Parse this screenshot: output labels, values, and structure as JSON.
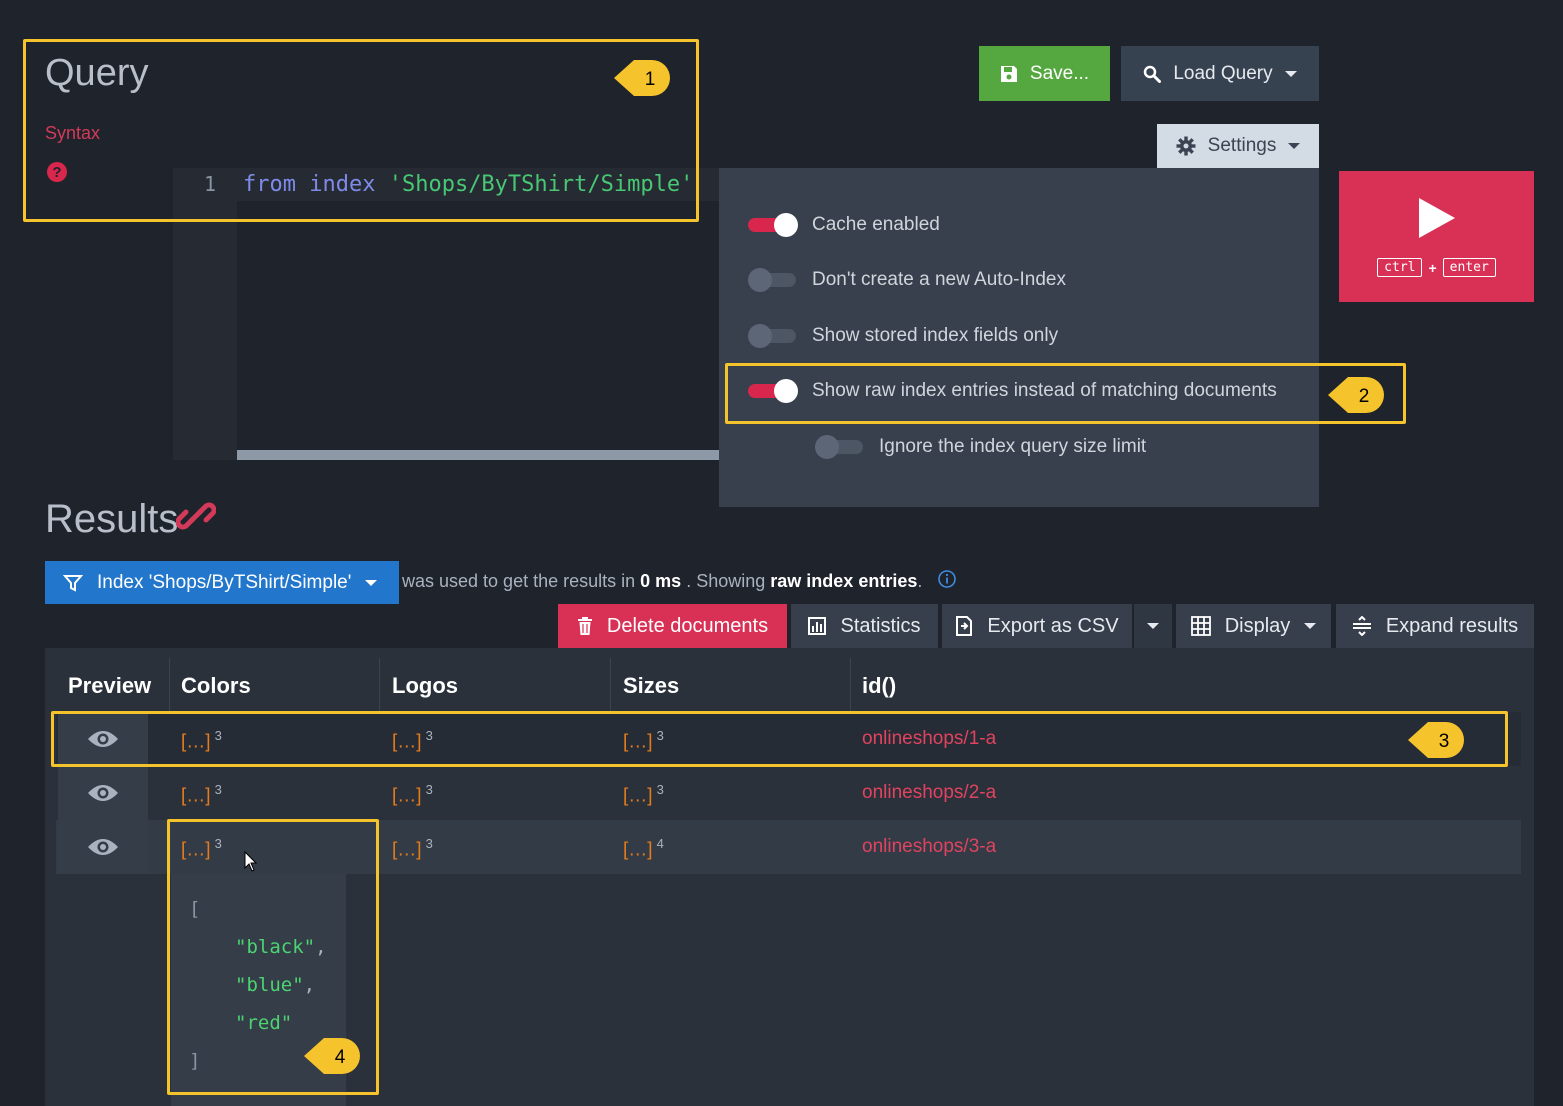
{
  "query": {
    "title": "Query",
    "syntax_label": "Syntax",
    "help_icon_glyph": "?",
    "line_number": "1",
    "code": {
      "kw1": "from",
      "kw2": "index",
      "str": "'Shops/ByTShirt/Simple'"
    }
  },
  "toolbar": {
    "save_label": "Save...",
    "load_query_label": "Load Query",
    "settings_label": "Settings",
    "run_shortcut": {
      "key1": "ctrl",
      "plus": "+",
      "key2": "enter"
    }
  },
  "settings": [
    {
      "label": "Cache enabled",
      "on": true
    },
    {
      "label": "Don't create a new Auto-Index",
      "on": false
    },
    {
      "label": "Show stored index fields only",
      "on": false
    },
    {
      "label": "Show raw index entries instead of matching documents",
      "on": true
    },
    {
      "label": "Ignore the index query size limit",
      "on": false
    }
  ],
  "callouts": [
    "1",
    "2",
    "3",
    "4"
  ],
  "results": {
    "title": "Results",
    "index_button": "Index 'Shops/ByTShirt/Simple'",
    "info": {
      "pre": "was used to get the results in",
      "time": "0 ms",
      "mid": ". Showing",
      "mode": "raw index entries",
      "end": "."
    },
    "actions": {
      "delete": "Delete documents",
      "statistics": "Statistics",
      "export": "Export as CSV",
      "display": "Display",
      "expand": "Expand results"
    },
    "columns": [
      "Preview",
      "Colors",
      "Logos",
      "Sizes",
      "id()"
    ],
    "rows": [
      {
        "colors": "[…]",
        "colors_n": "3",
        "logos": "[…]",
        "logos_n": "3",
        "sizes": "[…]",
        "sizes_n": "3",
        "id": "onlineshops/1-a"
      },
      {
        "colors": "[…]",
        "colors_n": "3",
        "logos": "[…]",
        "logos_n": "3",
        "sizes": "[…]",
        "sizes_n": "3",
        "id": "onlineshops/2-a"
      },
      {
        "colors": "[…]",
        "colors_n": "3",
        "logos": "[…]",
        "logos_n": "3",
        "sizes": "[…]",
        "sizes_n": "4",
        "id": "onlineshops/3-a"
      }
    ],
    "popup": {
      "open": "[",
      "items": [
        "\"black\"",
        "\"blue\"",
        "\"red\""
      ],
      "close": "]"
    }
  },
  "colors": {
    "accent_red": "#d93055",
    "save_green": "#55a83f",
    "index_blue": "#2277cc",
    "callout_yellow": "#f5c32c"
  }
}
